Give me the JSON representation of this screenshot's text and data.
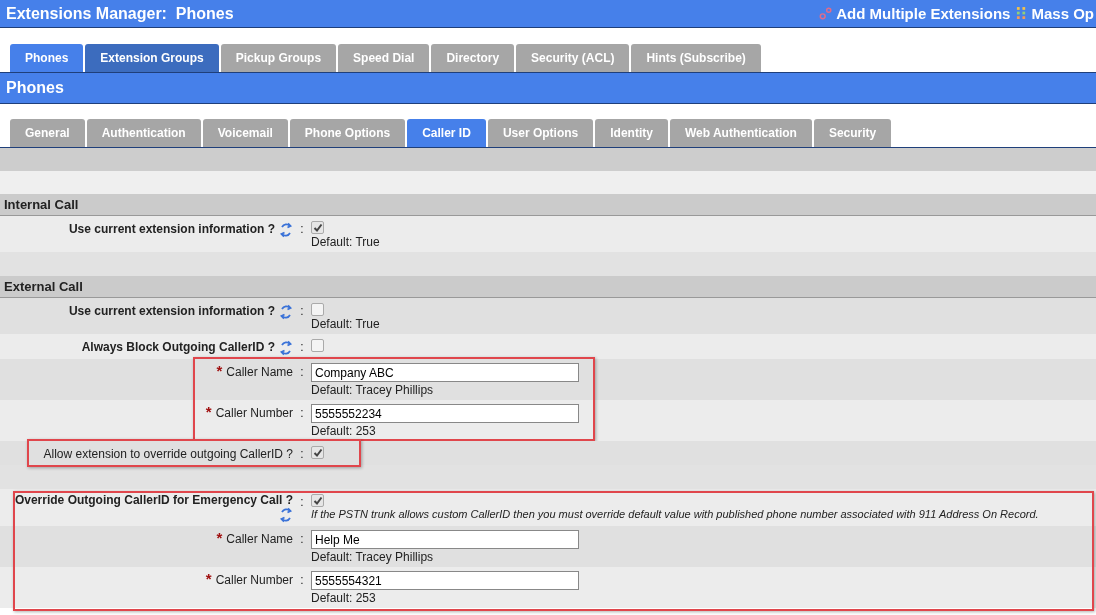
{
  "header": {
    "title": "Extensions Manager:  Phones",
    "actions": [
      {
        "label": "Add Multiple Extensions",
        "kind": "link"
      },
      {
        "label": "Mass Op",
        "kind": "grid"
      }
    ]
  },
  "tabs": [
    {
      "label": "Phones",
      "selected": true,
      "hover": false
    },
    {
      "label": "Extension Groups",
      "selected": false,
      "hover": true
    },
    {
      "label": "Pickup Groups",
      "selected": false,
      "hover": false
    },
    {
      "label": "Speed Dial",
      "selected": false,
      "hover": false
    },
    {
      "label": "Directory",
      "selected": false,
      "hover": false
    },
    {
      "label": "Security (ACL)",
      "selected": false,
      "hover": false
    },
    {
      "label": "Hints (Subscribe)",
      "selected": false,
      "hover": false
    }
  ],
  "section_title": "Phones",
  "subtabs": [
    {
      "label": "General",
      "selected": false
    },
    {
      "label": "Authentication",
      "selected": false
    },
    {
      "label": "Voicemail",
      "selected": false
    },
    {
      "label": "Phone Options",
      "selected": false
    },
    {
      "label": "Caller ID",
      "selected": true
    },
    {
      "label": "User Options",
      "selected": false
    },
    {
      "label": "Identity",
      "selected": false
    },
    {
      "label": "Web Authentication",
      "selected": false
    },
    {
      "label": "Security",
      "selected": false
    }
  ],
  "sections": [
    {
      "title": "Internal Call",
      "groups": [
        {
          "kind": "plain",
          "rows": [
            {
              "kind": "checkbox",
              "label": "Use current extension information ?",
              "bold": true,
              "reset": true,
              "separator": ":",
              "checked": true,
              "default": "Default: True"
            }
          ]
        }
      ]
    },
    {
      "title": "External Call",
      "groups": [
        {
          "kind": "plain",
          "rows": [
            {
              "kind": "checkbox",
              "label": "Use current extension information ?",
              "bold": true,
              "reset": true,
              "separator": ":",
              "checked": false,
              "default": "Default: True"
            },
            {
              "kind": "checkbox",
              "label": "Always Block Outgoing CallerID ?",
              "bold": true,
              "reset": true,
              "separator": ":",
              "checked": false
            }
          ]
        },
        {
          "kind": "values",
          "rows": [
            {
              "kind": "text",
              "marker": "*",
              "label": "Caller Name",
              "bold": false,
              "reset": false,
              "separator": ":",
              "value": "Company ABC",
              "default": "Default: Tracey Phillips"
            },
            {
              "kind": "text",
              "marker": "*",
              "label": "Caller Number",
              "bold": false,
              "reset": false,
              "separator": ":",
              "value": "5555552234",
              "default": "Default: 253"
            }
          ]
        },
        {
          "kind": "label",
          "rows": [
            {
              "kind": "checkbox",
              "label": "Allow extension to override outgoing CallerID ?",
              "bold": false,
              "reset": false,
              "separator": ":",
              "checked": true
            }
          ]
        },
        {
          "kind": "full",
          "rows": [
            {
              "kind": "checkbox",
              "label": "Override Outgoing CallerID for Emergency Call ?",
              "bold": true,
              "reset": true,
              "separator": ":",
              "checked": true,
              "note": "If the PSTN trunk allows custom CallerID then you must override default value with published phone number associated with 911 Address On Record."
            },
            {
              "kind": "text",
              "marker": "*",
              "label": "Caller Name",
              "bold": false,
              "reset": false,
              "separator": ":",
              "value": "Help Me",
              "default": "Default: Tracey Phillips"
            },
            {
              "kind": "text",
              "marker": "*",
              "label": "Caller Number",
              "bold": false,
              "reset": false,
              "separator": ":",
              "value": "5555554321",
              "default": "Default: 253"
            }
          ]
        }
      ]
    }
  ]
}
